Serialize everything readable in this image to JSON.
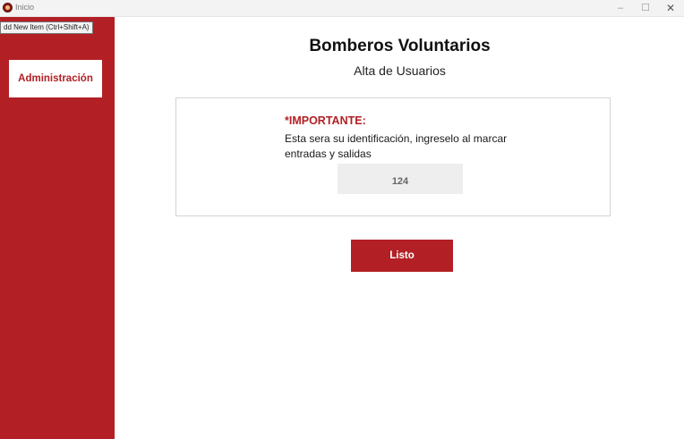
{
  "window": {
    "title": "Inicio",
    "icon": "bomberos-logo-icon",
    "minimize_glyph": "–",
    "maximize_glyph": "☐",
    "close_glyph": "✕"
  },
  "tooltip": {
    "text": "dd New Item (Ctrl+Shift+A)"
  },
  "sidebar": {
    "items": [
      {
        "label": "Administración"
      }
    ]
  },
  "header": {
    "title": "Bomberos Voluntarios",
    "subtitle": "Alta de Usuarios"
  },
  "notice": {
    "label": "*IMPORTANTE:",
    "text": "Esta sera su identificación, ingreselo al marcar entradas y salidas"
  },
  "id_field": {
    "value": "124"
  },
  "actions": {
    "done_label": "Listo"
  },
  "colors": {
    "accent": "#b22025",
    "field_bg": "#eeeeee",
    "titlebar_bg": "#f3f3f3"
  }
}
